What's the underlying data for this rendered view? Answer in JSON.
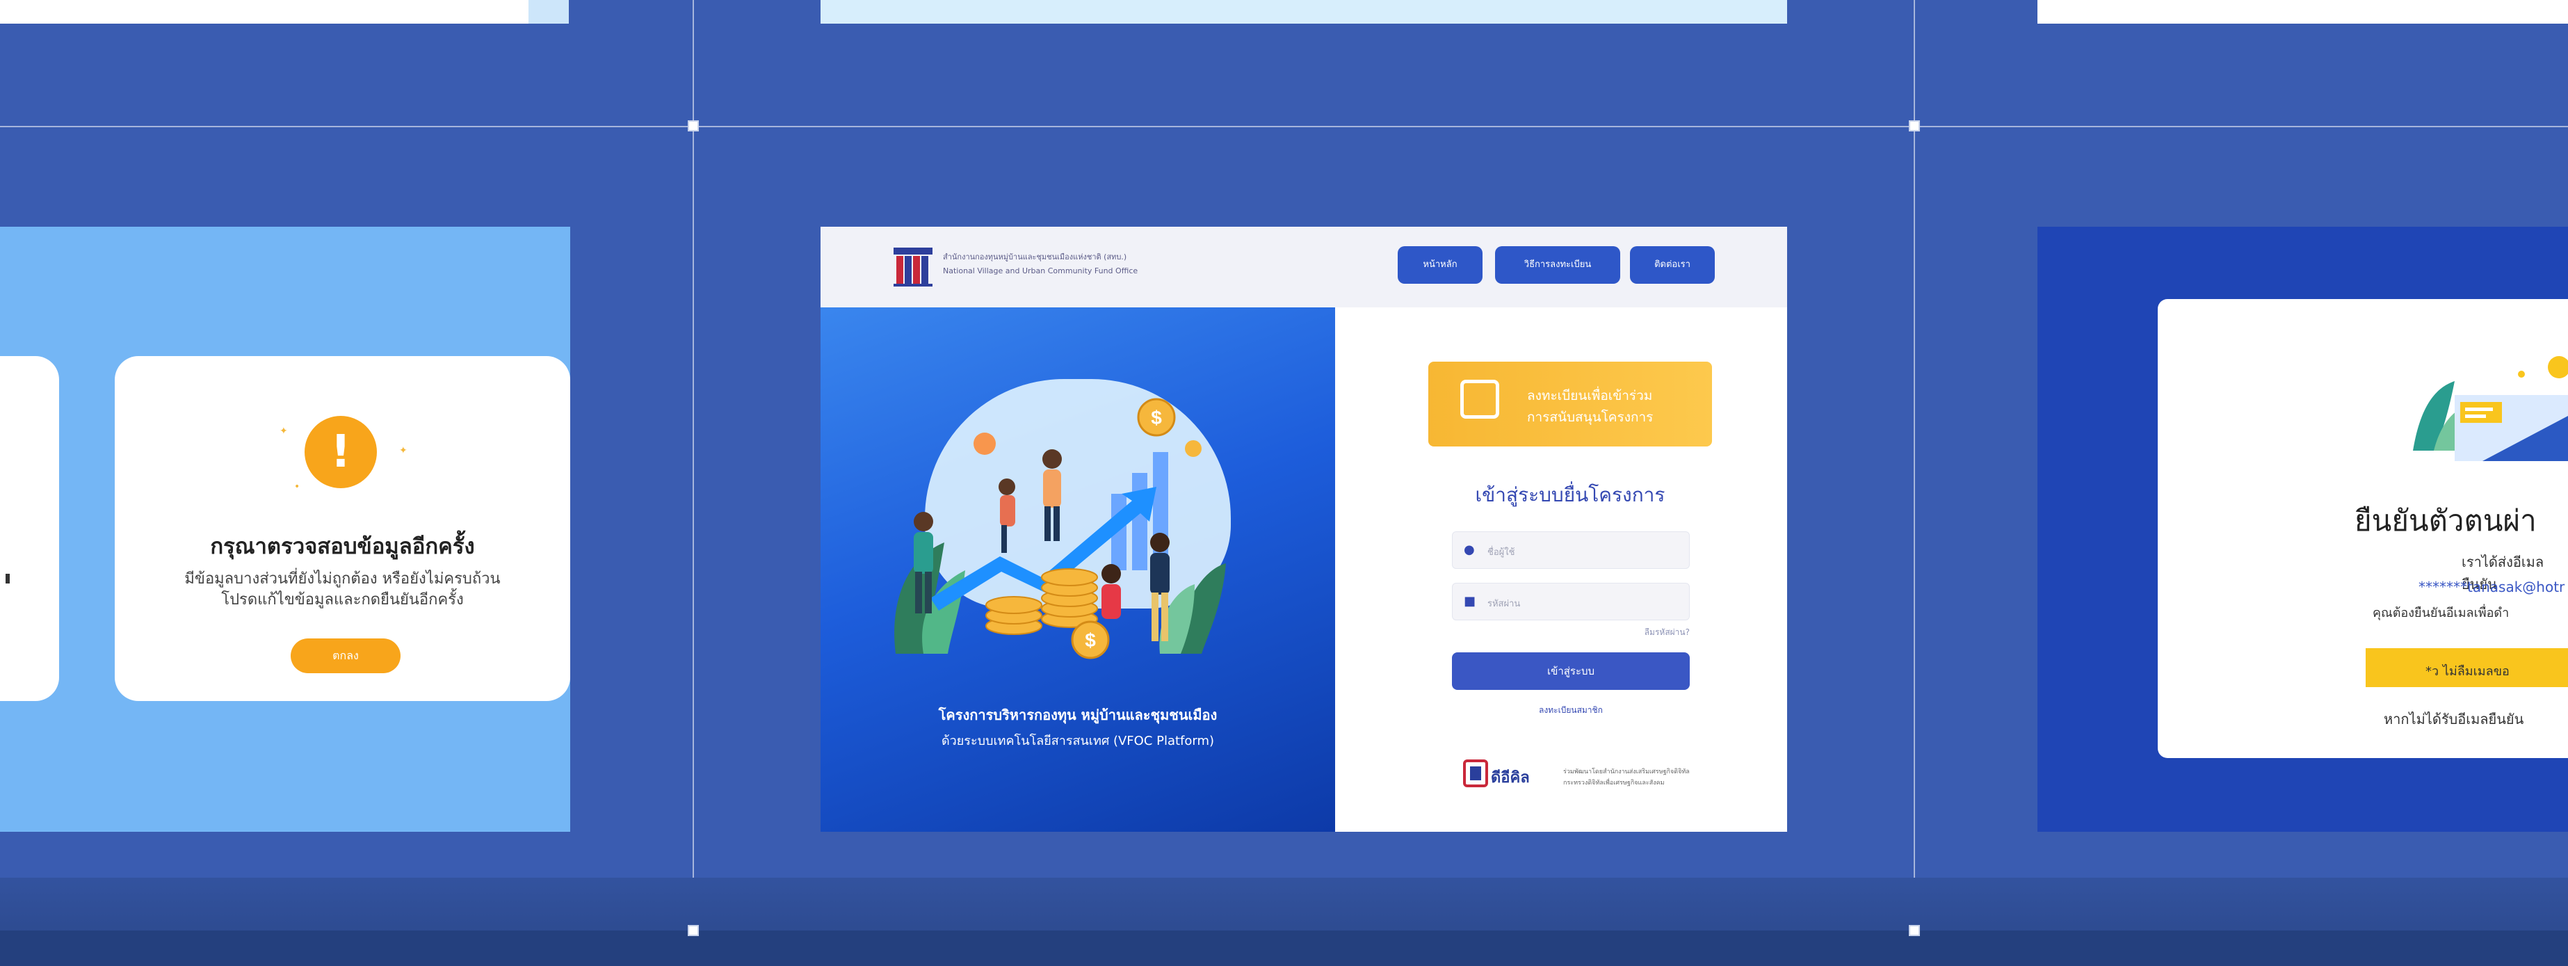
{
  "alert": {
    "icon": "exclamation-icon",
    "title": "กรุณาตรวจสอบข้อมูลอีกครั้ง",
    "message_line1": "มีข้อมูลบางส่วนที่ยังไม่ถูกต้อง หรือยังไม่ครบถ้วน",
    "message_line2": "โปรดแก้ไขข้อมูลและกดยืนยันอีกครั้ง",
    "button_label": "ตกลง"
  },
  "login_page": {
    "logo_line1": "สำนักงานกองทุนหมู่บ้านและชุมชนเมืองแห่งชาติ (สทบ.)",
    "logo_line2": "National Village and Urban Community Fund Office",
    "nav": [
      "หน้าหลัก",
      "วิธีการลงทะเบียน",
      "ติดต่อเรา"
    ],
    "hero_caption_line1": "โครงการบริหารกองทุน หมู่บ้านและชุมชนเมือง",
    "hero_caption_line2": "ด้วยระบบเทคโนโลยีสารสนเทศ (VFOC Platform)",
    "register_line1": "ลงทะเบียนเพื่อเข้าร่วม",
    "register_line2": "การสนับสนุนโครงการ",
    "title": "เข้าสู่ระบบยื่นโครงการ",
    "username_placeholder": "ชื่อผู้ใช้",
    "password_placeholder": "รหัสผ่าน",
    "forgot_password": "ลืมรหัสผ่าน?",
    "login_button": "เข้าสู่ระบบ",
    "register_link": "ลงทะเบียนสมาชิก",
    "footer_brand": "ดีอีคิล",
    "footer_line1": "ร่วมพัฒนาโดยสำนักงานส่งเสริมเศรษฐกิจดิจิทัล",
    "footer_line2": "กระทรวงดิจิทัลเพื่อเศรษฐกิจและสังคม"
  },
  "verify": {
    "title": "ยืนยันตัวตนผ่า",
    "line1": "เราได้ส่งอีเมลยืนยัน",
    "email": "*******tanasak@hotr",
    "line3": "คุณต้องยืนยันอีเมลเพื่อดำ",
    "notice": "*ว ไม่ลืมเมลขอ",
    "bottom": "หากไม่ได้รับอีเมลยืนยัน"
  },
  "colors": {
    "canvas": "#3a5cb1",
    "accent_orange": "#f8a51b",
    "primary_blue": "#2e57c8",
    "alert_bg": "#74b6f5",
    "verify_bg": "#1f45b5"
  }
}
